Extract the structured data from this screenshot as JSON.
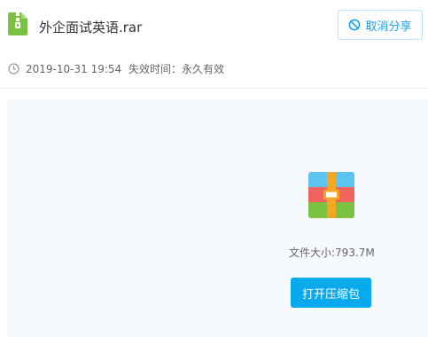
{
  "header": {
    "file_icon": "zip-file-icon",
    "file_name": "外企面试英语.rar",
    "cancel_share": {
      "icon": "ban-icon",
      "label": "取消分享"
    }
  },
  "meta": {
    "clock_icon": "clock-icon",
    "share_time": "2019-10-31 19:54",
    "expiry": "失效时间：永久有效"
  },
  "preview": {
    "archive_icon": "archive-icon",
    "file_size": "文件大小:793.7M",
    "open_button_label": "打开压缩包"
  },
  "colors": {
    "accent": "#09a9ee",
    "link": "#1aa3e8",
    "panel_bg": "#f6f9fd",
    "text_primary": "#333333",
    "text_secondary": "#666666"
  }
}
